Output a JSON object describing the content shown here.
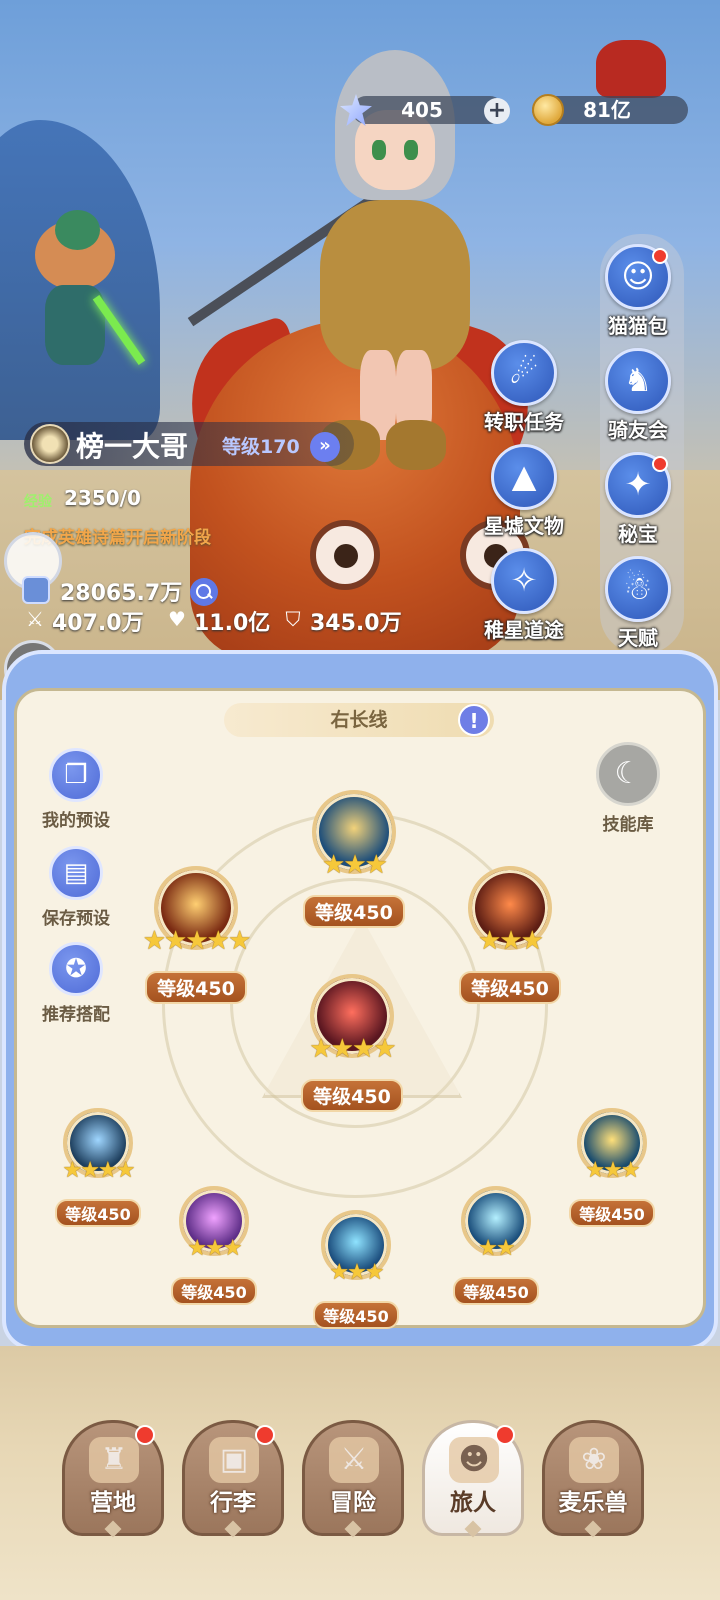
{
  "currency": {
    "gems": "405",
    "gold": "81亿",
    "icons": {
      "gem": "star-crystal-icon",
      "gold": "gold-coin-icon",
      "add": "plus-icon"
    }
  },
  "player": {
    "name": "榜一大哥",
    "level_text": "等级170",
    "exp_label": "经验",
    "exp_value": "2350/0",
    "quest_hint": "完成英雄诗篇开启新阶段",
    "power": "28065.7万",
    "stats": {
      "attack": "407.0万",
      "hp": "11.0亿",
      "defense": "345.0万"
    }
  },
  "right_menu": [
    {
      "label": "猫猫包",
      "icon": "cat-bag-icon",
      "badge": true
    },
    {
      "label": "骑友会",
      "icon": "horse-icon",
      "badge": false
    },
    {
      "label": "秘宝",
      "icon": "treasure-icon",
      "badge": true
    },
    {
      "label": "天赋",
      "icon": "brain-icon",
      "badge": false
    }
  ],
  "center_menu": [
    {
      "label": "转职任务",
      "icon": "class-change-icon"
    },
    {
      "label": "星墟文物",
      "icon": "mountain-relic-icon"
    },
    {
      "label": "稚星道途",
      "icon": "star-path-icon"
    }
  ],
  "skill_panel": {
    "loadout_name": "右长线",
    "tools": [
      {
        "label": "我的预设",
        "icon": "preset-icon"
      },
      {
        "label": "保存预设",
        "icon": "save-icon"
      },
      {
        "label": "推荐搭配",
        "icon": "recommend-icon"
      }
    ],
    "library_label": "技能库",
    "skills": [
      {
        "level": "等级450",
        "stars": 3,
        "color_a": "#1f4f7a",
        "color_b": "#f2d27a"
      },
      {
        "level": "等级450",
        "stars": 5,
        "color_a": "#7a2a12",
        "color_b": "#ffcf72"
      },
      {
        "level": "等级450",
        "stars": 3,
        "color_a": "#5e1e14",
        "color_b": "#ff8a4a"
      },
      {
        "level": "等级450",
        "stars": 4,
        "color_a": "#5a1620",
        "color_b": "#ff6f5e"
      },
      {
        "level": "等级450",
        "stars": 4,
        "color_a": "#1e3f5e",
        "color_b": "#9fd6ff"
      },
      {
        "level": "等级450",
        "stars": 3,
        "color_a": "#5e2e88",
        "color_b": "#f0a2ff"
      },
      {
        "level": "等级450",
        "stars": 3,
        "color_a": "#1c4e7e",
        "color_b": "#8fe3ff"
      },
      {
        "level": "等级450",
        "stars": 2,
        "color_a": "#1b4f7c",
        "color_b": "#b4f0ff"
      },
      {
        "level": "等级450",
        "stars": 3,
        "color_a": "#184b6e",
        "color_b": "#ffe07a"
      }
    ]
  },
  "bottom_nav": [
    {
      "label": "营地",
      "icon": "castle-icon",
      "badge": true,
      "active": false
    },
    {
      "label": "行李",
      "icon": "luggage-icon",
      "badge": true,
      "active": false
    },
    {
      "label": "冒险",
      "icon": "crossed-swords-icon",
      "badge": false,
      "active": false
    },
    {
      "label": "旅人",
      "icon": "traveler-portrait-icon",
      "badge": true,
      "active": true
    },
    {
      "label": "麦乐兽",
      "icon": "pet-face-icon",
      "badge": false,
      "active": false
    }
  ]
}
